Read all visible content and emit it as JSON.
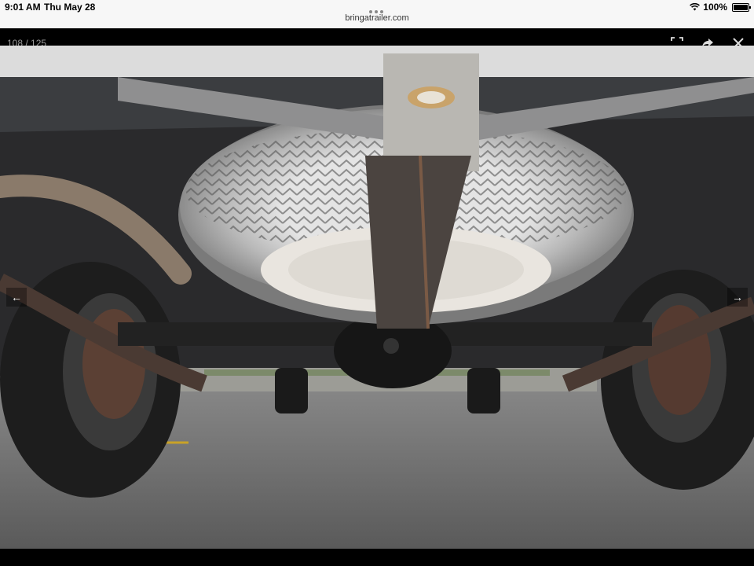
{
  "status_bar": {
    "time": "9:01 AM",
    "date": "Thu May 28",
    "url": "bringatrailer.com",
    "battery": "100%"
  },
  "lightbox": {
    "counter": "108 / 125",
    "icons": [
      "fullscreen-icon",
      "share-icon",
      "close-icon"
    ]
  },
  "photo": {
    "description_icons": [
      "left-arrow-icon",
      "right-arrow-icon"
    ]
  },
  "colors": {
    "status_bg": "#f7f7f7",
    "lightbox_bg": "#000000",
    "counter_text": "#999999"
  }
}
